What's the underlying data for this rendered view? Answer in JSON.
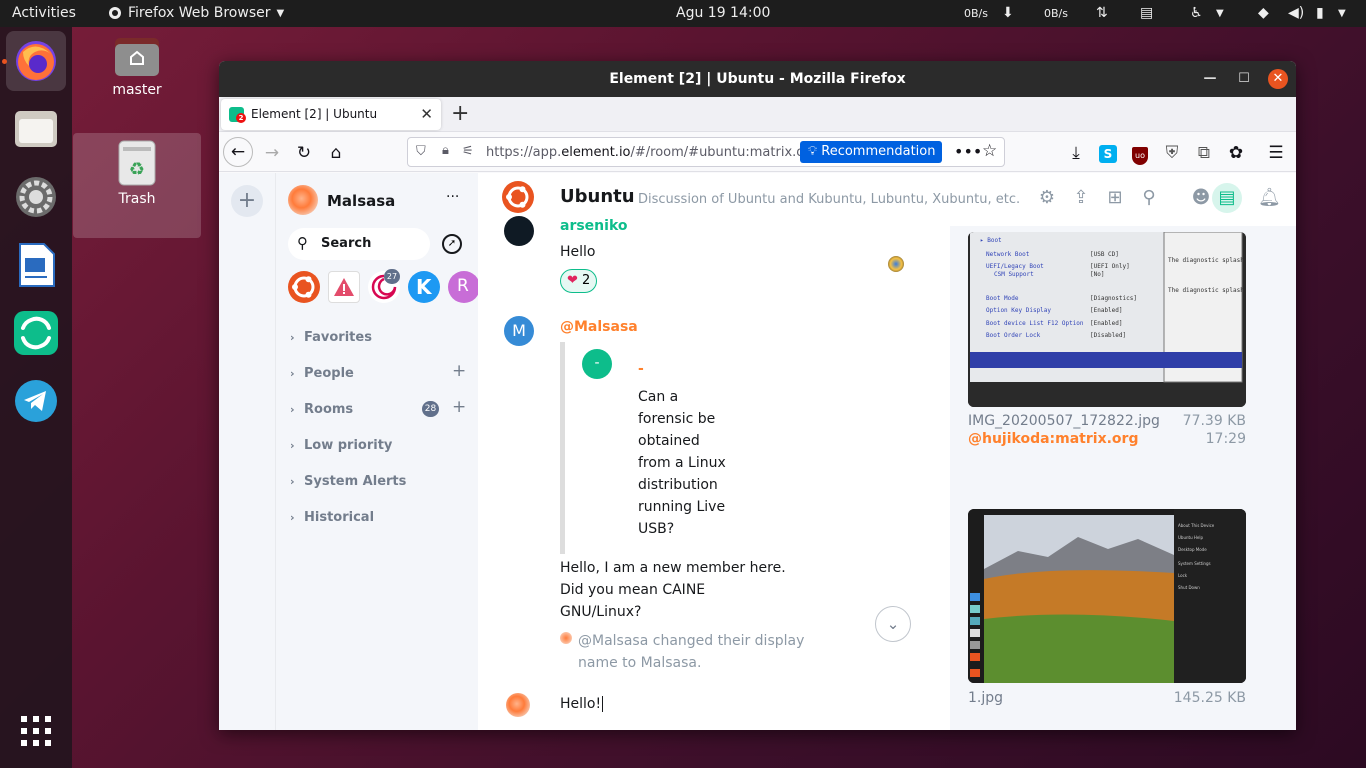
{
  "topbar": {
    "activities": "Activities",
    "app_name": "Firefox Web Browser",
    "clock": "Agu 19  14:00",
    "net_down": "0B/s",
    "net_up": "0B/s"
  },
  "desktop": {
    "home_label": "master",
    "trash_label": "Trash"
  },
  "window": {
    "title": "Element [2] | Ubuntu - Mozilla Firefox"
  },
  "tab": {
    "label": "Element [2] | Ubuntu",
    "badge": "2"
  },
  "urlbar": {
    "url_prefix": "https://app.",
    "url_domain": "element.io",
    "url_suffix": "/#/room/#ubuntu:matrix.org",
    "recommendation": "Recommendation"
  },
  "sidebar": {
    "user": "Malsasa",
    "search": "Search",
    "space_badge": "27",
    "sections": [
      {
        "label": "Favorites"
      },
      {
        "label": "People"
      },
      {
        "label": "Rooms",
        "count": "28"
      },
      {
        "label": "Low priority"
      },
      {
        "label": "System Alerts"
      },
      {
        "label": "Historical"
      }
    ]
  },
  "room": {
    "name": "Ubuntu",
    "topic": "Discussion of Ubuntu and Kubuntu, Lubuntu, Xubuntu, etc."
  },
  "timeline": {
    "msg1_sender": "arseniko",
    "msg1_text": "Hello",
    "reaction_count": "2",
    "msg2_sender": "@Malsasa",
    "msg2_avatar": "M",
    "quote_avatar": "-",
    "quote_sender": "-",
    "quote_lines": [
      "Can a",
      "forensic be",
      "obtained",
      "from a Linux",
      "distribution",
      "running Live",
      "USB?"
    ],
    "reply_lines": [
      "Hello, I am a new member here.",
      "Did you mean CAINE",
      "GNU/Linux?"
    ],
    "event_lines": [
      "@Malsasa changed their display",
      "name to Malsasa."
    ]
  },
  "composer": {
    "value": "Hello!"
  },
  "files": [
    {
      "name": "IMG_20200507_172822.jpg",
      "size": "77.39 KB",
      "sender": "@hujikoda:matrix.org",
      "time": "17:29"
    },
    {
      "name": "1.jpg",
      "size": "145.25 KB"
    }
  ],
  "colors": {
    "accent_green": "#0dbd8b",
    "ubuntu_orange": "#e95420",
    "firefox_blue": "#0061e0"
  }
}
